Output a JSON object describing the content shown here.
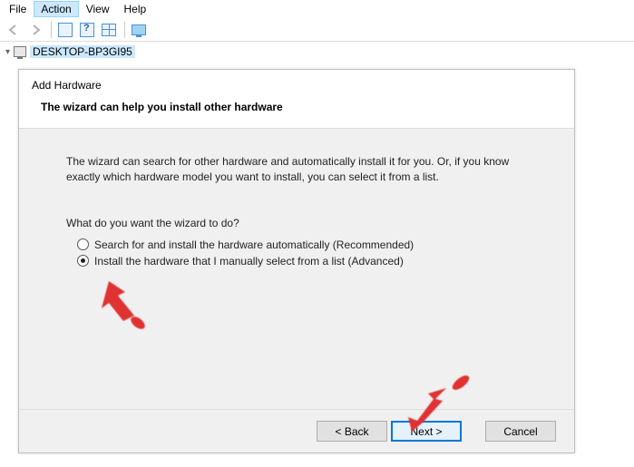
{
  "menu": {
    "file": "File",
    "action": "Action",
    "view": "View",
    "help": "Help"
  },
  "tree": {
    "node": "DESKTOP-BP3GI95"
  },
  "wizard": {
    "title": "Add Hardware",
    "subtitle": "The wizard can help you install other hardware",
    "desc": "The wizard can search for other hardware and automatically install it for you. Or, if you know exactly which hardware model you want to install, you can select it from a list.",
    "question": "What do you want the wizard to do?",
    "opt1": "Search for and install the hardware automatically (Recommended)",
    "opt2": "Install the hardware that I manually select from a list (Advanced)",
    "back": "< Back",
    "next": "Next >",
    "cancel": "Cancel"
  }
}
